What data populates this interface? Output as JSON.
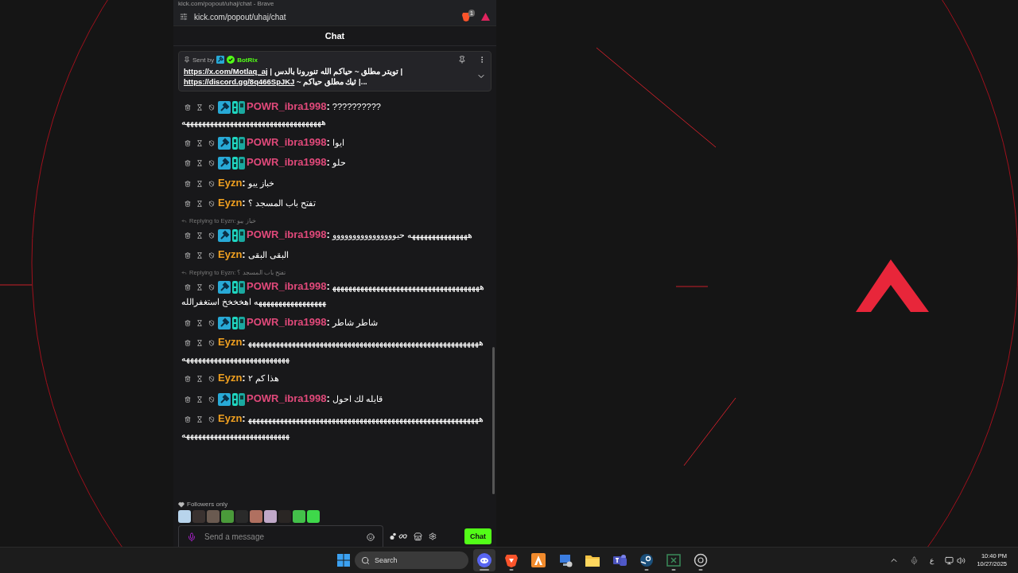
{
  "window": {
    "title": "kick.com/popout/uhaj/chat - Brave",
    "url": "kick.com/popout/uhaj/chat",
    "extension_count": "1"
  },
  "chat": {
    "title": "Chat",
    "pinned": {
      "sent_by": "Sent by",
      "author": "BotRix",
      "lines": [
        {
          "link": "https://x.com/Motlaq_aj",
          "text": " | تويتر مطلق ~ حياكم الله تنورونا بالدس |"
        },
        {
          "link": "https://discord.gg/8q466SpJKJ",
          "text": " ~ ثيك مطلق حياكم |..."
        }
      ]
    },
    "messages": [
      {
        "user": "POWR_ibra1998",
        "sep": ":",
        "color": "#e0497a",
        "badges": true,
        "text": "?????????? هههههههههههههههههههههههههههههههههههه"
      },
      {
        "user": "POWR_ibra1998",
        "sep": ":",
        "color": "#e0497a",
        "badges": true,
        "text": "ايوا"
      },
      {
        "user": "POWR_ibra1998",
        "sep": ":",
        "color": "#e0497a",
        "badges": true,
        "text": "حلو"
      },
      {
        "user": "Eyzn",
        "sep": ":",
        "color": "#f0a020",
        "badges": false,
        "text": "خباز يبو"
      },
      {
        "user": "Eyzn",
        "sep": ":",
        "color": "#f0a020",
        "badges": false,
        "text": "تفتح باب المسجد ؟"
      },
      {
        "reply": "Replying to Eyzn: خباز يبو",
        "user": "POWR_ibra1998",
        "sep": ":",
        "color": "#e0497a",
        "badges": true,
        "text": "هههههههههههههههه حيوووووووووووووووو"
      },
      {
        "user": "Eyzn",
        "sep": ":",
        "color": "#f0a020",
        "badges": false,
        "text": "البقى البقى"
      },
      {
        "reply": "Replying to Eyzn: تفتح باب المسجد ؟",
        "user": "POWR_ibra1998",
        "sep": ":",
        "color": "#e0497a",
        "badges": true,
        "text": "هههههههههههههههههههههههههههههههههههههههههههههههههههههههه اهخخخخ استغفرالله"
      },
      {
        "user": "POWR_ibra1998",
        "sep": ":",
        "color": "#e0497a",
        "badges": true,
        "text": "شاطر شاطر"
      },
      {
        "user": "Eyzn",
        "sep": ":",
        "color": "#f0a020",
        "badges": false,
        "text": "هههههههههههههههههههههههههههههههههههههههههههههههههههههههههههههههههههههههههههههههههههههه"
      },
      {
        "user": "Eyzn",
        "sep": ":",
        "color": "#f0a020",
        "badges": false,
        "text": "هذا كم ٢"
      },
      {
        "user": "POWR_ibra1998",
        "sep": ":",
        "color": "#e0497a",
        "badges": true,
        "text": "قايله لك احول"
      },
      {
        "user": "Eyzn",
        "sep": ":",
        "color": "#f0a020",
        "badges": false,
        "text": "هههههههههههههههههههههههههههههههههههههههههههههههههههههههههههههههههههههههههههههههههههههه"
      }
    ],
    "mode": "Followers only",
    "emotes": [
      {
        "color": "#b8d4ec"
      },
      {
        "color": "#3a3230"
      },
      {
        "color": "#6a5a50"
      },
      {
        "color": "#4a9a3a"
      },
      {
        "color": "#2a2a2a"
      },
      {
        "color": "#b07060"
      },
      {
        "color": "#c0a8c8"
      },
      {
        "color": "#2a2624"
      },
      {
        "color": "#43c04a"
      },
      {
        "color": "#3ed84a"
      }
    ],
    "input": {
      "placeholder": "Send a message"
    },
    "send_button": "Chat"
  },
  "taskbar": {
    "search": {
      "placeholder": "Search"
    },
    "apps": [
      {
        "kind": "discord",
        "selected": true,
        "running": true
      },
      {
        "kind": "brave",
        "selected": false,
        "running": true
      },
      {
        "kind": "orange",
        "selected": false,
        "running": false
      },
      {
        "kind": "computer",
        "selected": false,
        "running": false
      },
      {
        "kind": "folder",
        "selected": false,
        "running": false
      },
      {
        "kind": "teams",
        "selected": false,
        "running": false
      },
      {
        "kind": "steam",
        "selected": false,
        "running": true
      },
      {
        "kind": "sheet",
        "selected": false,
        "running": true
      },
      {
        "kind": "ring",
        "selected": false,
        "running": true
      }
    ],
    "language": "ع",
    "time": "10:40 PM",
    "date": "10/27/2025"
  }
}
